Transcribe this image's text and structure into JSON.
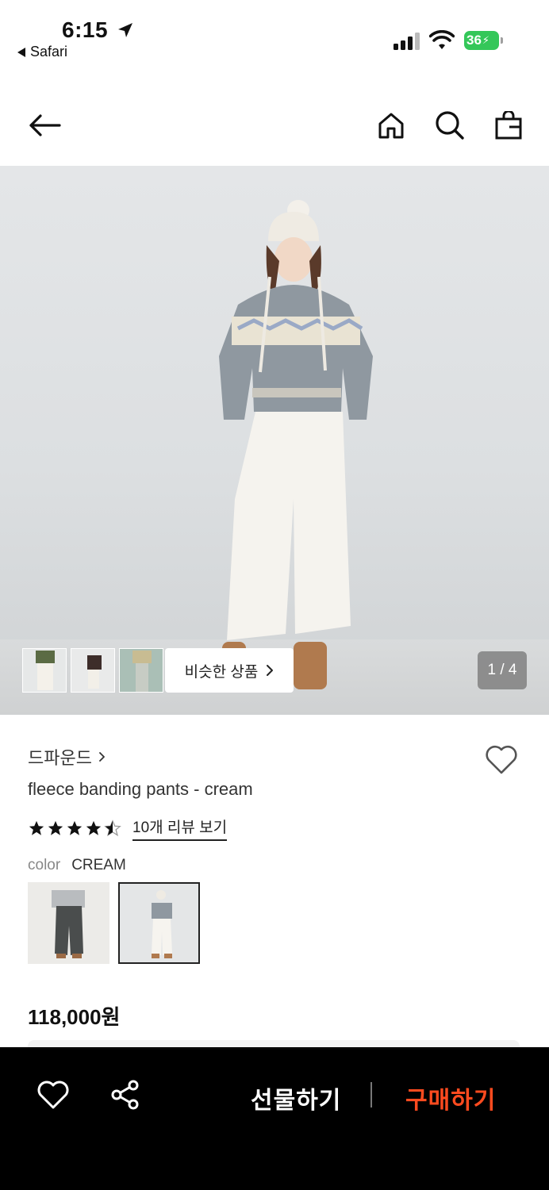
{
  "status_bar": {
    "time": "6:15",
    "back_app": "Safari",
    "battery": "36",
    "battery_color": "#34c759"
  },
  "nav": {
    "icons": [
      "back-arrow-icon",
      "home-icon",
      "search-icon",
      "shopping-bag-icon"
    ]
  },
  "gallery": {
    "similar_label": "비슷한 상품",
    "counter": "1 / 4",
    "current_image": 1,
    "total_images": 4
  },
  "product": {
    "brand": "드파운드",
    "name": "fleece banding pants - cream",
    "rating": 4.5,
    "rating_max": 5,
    "review_link": "10개 리뷰 보기",
    "color_label": "color",
    "color_value": "CREAM",
    "price": "118,000원"
  },
  "bottom_bar": {
    "gift_label": "선물하기",
    "buy_label": "구매하기",
    "buy_color": "#ff4b1f"
  }
}
